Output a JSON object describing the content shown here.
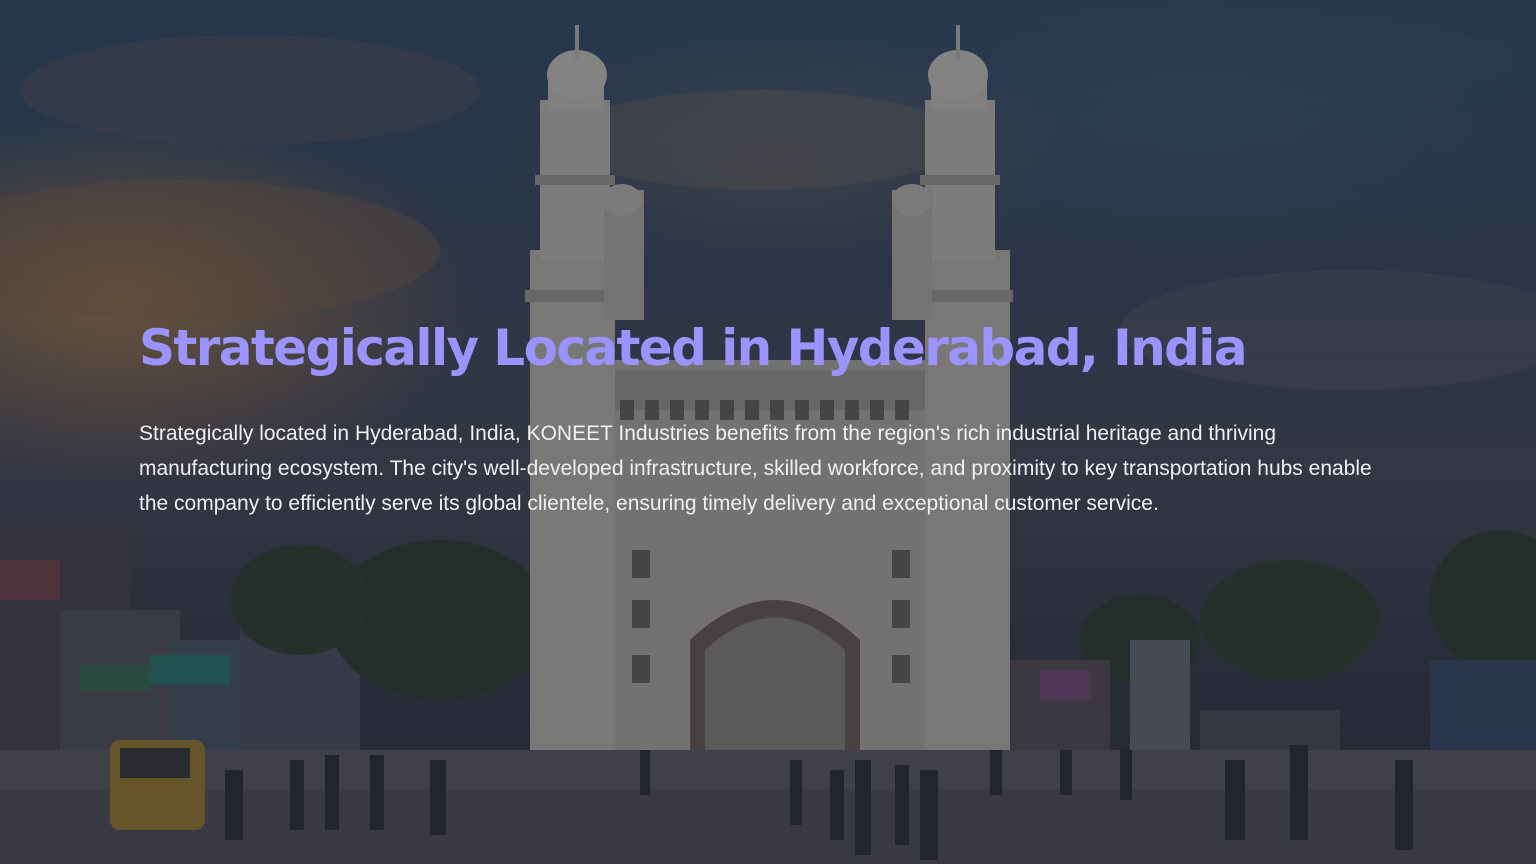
{
  "hero": {
    "title": "Strategically Located in Hyderabad, India",
    "description": "Strategically located in Hyderabad, India, KONEET Industries benefits from the region's rich industrial heritage and thriving manufacturing ecosystem. The city's well-developed infrastructure, skilled workforce, and proximity to key transportation hubs enable the company to efficiently serve its global clientele, ensuring timely delivery and exceptional customer service.",
    "background_image": "charminar-monument-photo",
    "colors": {
      "title": "#9b93ff",
      "text": "#eef0f4",
      "overlay": "#141826"
    }
  }
}
